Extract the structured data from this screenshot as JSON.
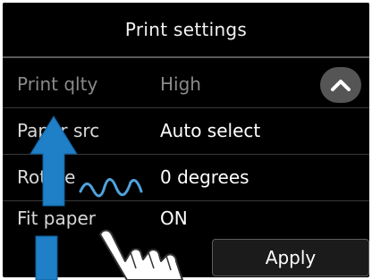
{
  "header": {
    "title": "Print settings"
  },
  "settings": [
    {
      "label": "Print qlty",
      "value": "High"
    },
    {
      "label": "Paper src",
      "value": "Auto select"
    },
    {
      "label": "Rotate",
      "value": "0 degrees"
    },
    {
      "label": "Fit paper",
      "value": "ON"
    }
  ],
  "apply_label": "Apply",
  "icons": {
    "scroll": "chevron-up-icon",
    "gesture": "swipe-up-gesture-icon"
  },
  "colors": {
    "screen_bg": "#000000",
    "text": "#ffffff",
    "arrow": "#1f7fc7",
    "button_border": "#5c5c5c"
  }
}
